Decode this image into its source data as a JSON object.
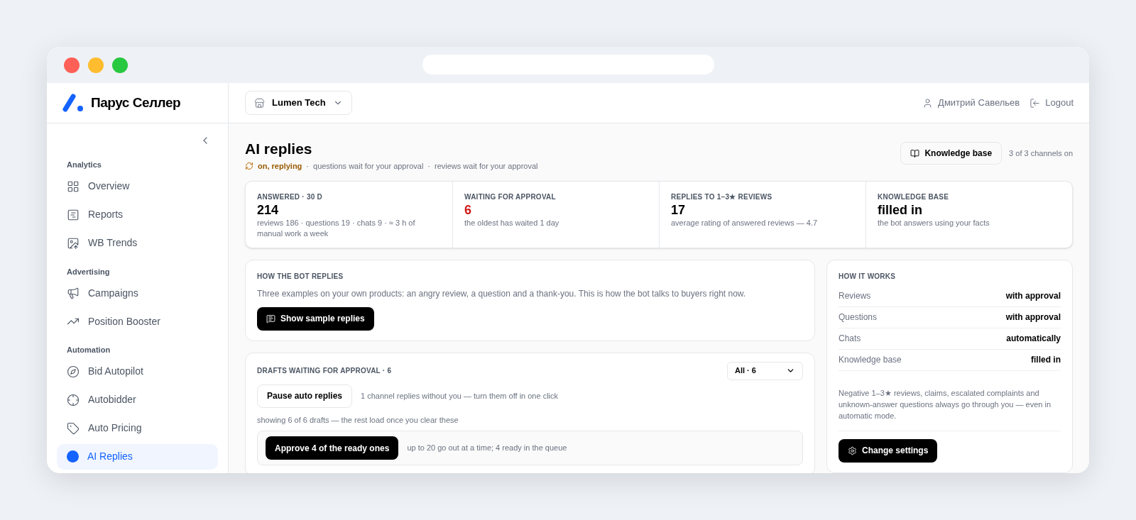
{
  "brand": {
    "name": "Парус Селлер"
  },
  "sidebar": {
    "sections": [
      {
        "title": "Analytics",
        "items": [
          {
            "label": "Overview",
            "selected": false
          },
          {
            "label": "Reports",
            "selected": false
          },
          {
            "label": "WB Trends",
            "selected": false
          }
        ]
      },
      {
        "title": "Advertising",
        "items": [
          {
            "label": "Campaigns",
            "selected": false
          },
          {
            "label": "Position Booster",
            "selected": false
          }
        ]
      },
      {
        "title": "Automation",
        "items": [
          {
            "label": "Bid Autopilot",
            "selected": false
          },
          {
            "label": "Autobidder",
            "selected": false
          },
          {
            "label": "Auto Pricing",
            "selected": false
          },
          {
            "label": "AI Replies",
            "selected": true
          }
        ]
      }
    ]
  },
  "header": {
    "store": "Lumen Tech",
    "user": "Дмитрий Савельев",
    "logout": "Logout"
  },
  "page": {
    "title": "AI replies",
    "status": "on, replying",
    "separator": "·",
    "notes": [
      "questions wait for your approval",
      "reviews wait for your approval"
    ],
    "knowledge_button": "Knowledge base",
    "channels": "3 of 3 channels on"
  },
  "stats": [
    {
      "label": "ANSWERED · 30 D",
      "value": "214",
      "note": "reviews 186 · questions 19 · chats 9 · ≈ 3 h of manual work a week",
      "alert": false
    },
    {
      "label": "WAITING FOR APPROVAL",
      "value": "6",
      "note": "the oldest has waited 1 day",
      "alert": true
    },
    {
      "label": "REPLIES TO 1–3★ REVIEWS",
      "value": "17",
      "note": "average rating of answered reviews — 4.7",
      "alert": false
    },
    {
      "label": "KNOWLEDGE BASE",
      "value": "filled in",
      "note": "the bot answers using your facts",
      "alert": false
    }
  ],
  "samples": {
    "title": "HOW THE BOT REPLIES",
    "text": "Three examples on your own products: an angry review, a question and a thank-you. This is how the bot talks to buyers right now.",
    "button": "Show sample replies"
  },
  "drafts": {
    "title": "DRAFTS WAITING FOR APPROVAL · 6",
    "filter": "All · 6",
    "pause_button": "Pause auto replies",
    "pause_note": "1 channel replies without you — turn them off in one click",
    "showing": "showing 6 of 6 drafts — the rest load once you clear these",
    "approve_button": "Approve 4 of the ready ones",
    "approve_note": "up to 20 go out at a time; 4 ready in the queue"
  },
  "how_it_works": {
    "title": "HOW IT WORKS",
    "rows": [
      {
        "name": "Reviews",
        "value": "with approval"
      },
      {
        "name": "Questions",
        "value": "with approval"
      },
      {
        "name": "Chats",
        "value": "automatically"
      },
      {
        "name": "Knowledge base",
        "value": "filled in"
      }
    ],
    "note": "Negative 1–3★ reviews, claims, escalated complaints and unknown-answer questions always go through you — even in automatic mode.",
    "button": "Change settings"
  }
}
